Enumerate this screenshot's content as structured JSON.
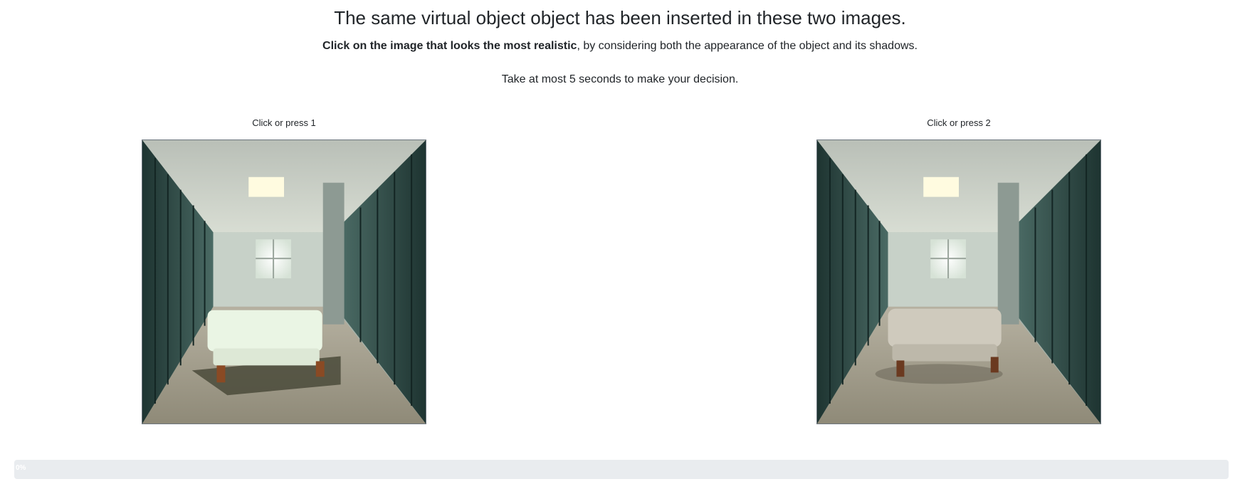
{
  "page": {
    "title": "The same virtual object object has been inserted in these two images.",
    "instruction_bold": "Click on the image that looks the most realistic",
    "instruction_rest": ", by considering both the appearance of the object and its shadows.",
    "timing": "Take at most 5 seconds to make your decision."
  },
  "choices": [
    {
      "label": "Click or press 1",
      "ottoman_color": "#eaf5e4",
      "shadow": "hard"
    },
    {
      "label": "Click or press 2",
      "ottoman_color": "#cfcabd",
      "shadow": "soft"
    }
  ],
  "progress": {
    "percent": 0,
    "text": "0%"
  },
  "colors": {
    "progress_track": "#e9ecef",
    "progress_fill": "#007bff",
    "locker": "#34504c"
  }
}
